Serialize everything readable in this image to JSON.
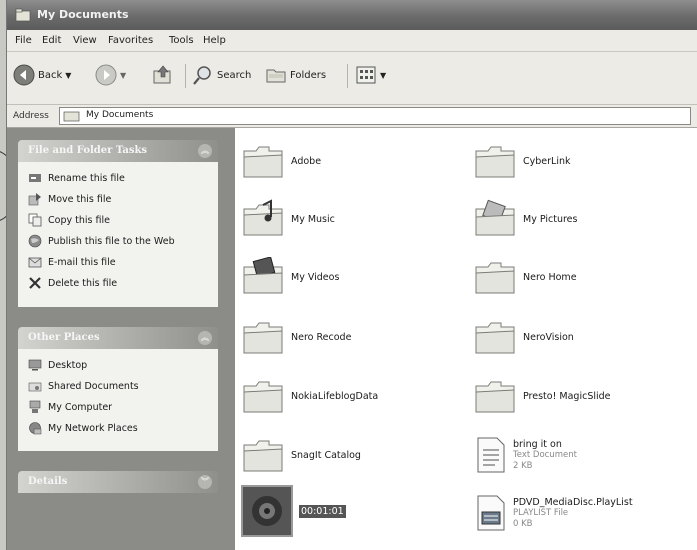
{
  "window": {
    "title": "My Documents"
  },
  "menu": [
    "File",
    "Edit",
    "View",
    "Favorites",
    "Tools",
    "Help"
  ],
  "toolbar": {
    "back": "Back",
    "search": "Search",
    "folders": "Folders"
  },
  "address": {
    "label": "Address",
    "value": "My Documents"
  },
  "tasks": {
    "title": "File and Folder Tasks",
    "items": [
      "Rename this file",
      "Move this file",
      "Copy this file",
      "Publish this file to the Web",
      "E-mail this file",
      "Delete this file"
    ]
  },
  "places": {
    "title": "Other Places",
    "items": [
      "Desktop",
      "Shared Documents",
      "My Computer",
      "My Network Places"
    ]
  },
  "details": {
    "title": "Details"
  },
  "files": [
    {
      "name": "Adobe"
    },
    {
      "name": "CyberLink"
    },
    {
      "name": "My Music"
    },
    {
      "name": "My Pictures"
    },
    {
      "name": "My Videos"
    },
    {
      "name": "Nero Home"
    },
    {
      "name": "Nero Recode"
    },
    {
      "name": "NeroVision"
    },
    {
      "name": "NokiaLifeblogData"
    },
    {
      "name": "Presto! MagicSlide"
    },
    {
      "name": "SnagIt Catalog"
    },
    {
      "name": "bring it on",
      "type": "Text Document",
      "size": "2 KB"
    },
    {
      "name": "00:01:01"
    },
    {
      "name": "PDVD_MediaDisc.PlayList",
      "type": "PLAYLIST File",
      "size": "0 KB"
    }
  ]
}
